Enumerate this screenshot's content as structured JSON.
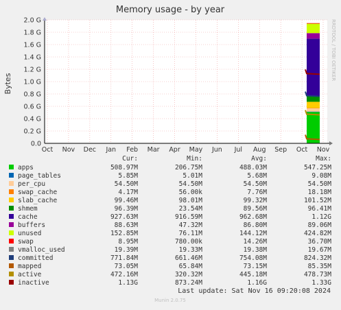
{
  "chart_data": {
    "type": "area",
    "title": "Memory usage - by year",
    "ylabel": "Bytes",
    "side_label": "RRDTOOL / TOBI OETIKER",
    "footer": "Munin 2.0.75",
    "last_update": "Last update: Sat Nov 16 09:20:08 2024",
    "ylim": [
      0,
      2000000000
    ],
    "y_ticks": [
      {
        "value": 0,
        "label": "0.0"
      },
      {
        "value": 200000000,
        "label": "0.2 G"
      },
      {
        "value": 400000000,
        "label": "0.4 G"
      },
      {
        "value": 600000000,
        "label": "0.6 G"
      },
      {
        "value": 800000000,
        "label": "0.8 G"
      },
      {
        "value": 1000000000,
        "label": "1.0 G"
      },
      {
        "value": 1200000000,
        "label": "1.2 G"
      },
      {
        "value": 1400000000,
        "label": "1.4 G"
      },
      {
        "value": 1600000000,
        "label": "1.6 G"
      },
      {
        "value": 1800000000,
        "label": "1.8 G"
      },
      {
        "value": 2000000000,
        "label": "2.0 G"
      }
    ],
    "x_ticks": [
      "Oct",
      "Nov",
      "Dec",
      "Jan",
      "Feb",
      "Mar",
      "Apr",
      "May",
      "Jun",
      "Jul",
      "Aug",
      "Sep",
      "Oct",
      "Nov"
    ],
    "legend_headers": {
      "cur": "Cur:",
      "min": "Min:",
      "avg": "Avg:",
      "max": "Max:"
    },
    "series": [
      {
        "name": "apps",
        "color": "#00cc00",
        "cur": "508.97M",
        "min": "206.75M",
        "avg": "488.03M",
        "max": "547.25M",
        "value": 508970000
      },
      {
        "name": "page_tables",
        "color": "#0066b3",
        "cur": "5.85M",
        "min": "5.01M",
        "avg": "5.68M",
        "max": "9.08M",
        "value": 5850000
      },
      {
        "name": "per_cpu",
        "color": "#ffcc99",
        "cur": "54.50M",
        "min": "54.50M",
        "avg": "54.50M",
        "max": "54.50M",
        "value": 54500000
      },
      {
        "name": "swap_cache",
        "color": "#ff8000",
        "cur": "4.17M",
        "min": "56.00k",
        "avg": "7.76M",
        "max": "18.18M",
        "value": 4170000
      },
      {
        "name": "slab_cache",
        "color": "#ffcc00",
        "cur": "99.46M",
        "min": "98.01M",
        "avg": "99.32M",
        "max": "101.52M",
        "value": 99460000
      },
      {
        "name": "shmem",
        "color": "#008f00",
        "cur": "96.39M",
        "min": "23.54M",
        "avg": "89.56M",
        "max": "96.41M",
        "value": 96390000
      },
      {
        "name": "cache",
        "color": "#330099",
        "cur": "927.63M",
        "min": "916.59M",
        "avg": "962.68M",
        "max": "1.12G",
        "value": 927630000
      },
      {
        "name": "buffers",
        "color": "#990099",
        "cur": "88.63M",
        "min": "47.32M",
        "avg": "86.80M",
        "max": "89.06M",
        "value": 88630000
      },
      {
        "name": "unused",
        "color": "#ccff00",
        "cur": "152.85M",
        "min": "76.11M",
        "avg": "144.12M",
        "max": "424.82M",
        "value": 152850000
      },
      {
        "name": "swap",
        "color": "#ff0000",
        "cur": "8.95M",
        "min": "780.00k",
        "avg": "14.26M",
        "max": "36.70M",
        "value": 8950000
      },
      {
        "name": "vmalloc_used",
        "color": "#808080",
        "cur": "19.39M",
        "min": "19.33M",
        "avg": "19.38M",
        "max": "19.67M",
        "value": 19390000
      },
      {
        "name": "committed",
        "color": "#1f3d7a",
        "cur": "771.84M",
        "min": "661.46M",
        "avg": "754.08M",
        "max": "824.32M",
        "value": 771840000
      },
      {
        "name": "mapped",
        "color": "#b35900",
        "cur": "73.05M",
        "min": "65.84M",
        "avg": "73.15M",
        "max": "85.35M",
        "value": 73050000
      },
      {
        "name": "active",
        "color": "#b38f00",
        "cur": "472.16M",
        "min": "320.32M",
        "avg": "445.18M",
        "max": "478.73M",
        "value": 472160000
      },
      {
        "name": "inactive",
        "color": "#990000",
        "cur": "1.13G",
        "min": "873.24M",
        "avg": "1.16G",
        "max": "1.33G",
        "value": 1130000000
      }
    ],
    "stacked": [
      "apps",
      "page_tables",
      "per_cpu",
      "swap_cache",
      "slab_cache",
      "shmem",
      "cache",
      "buffers",
      "unused",
      "swap"
    ],
    "lines": [
      "committed",
      "mapped",
      "active",
      "inactive"
    ]
  }
}
